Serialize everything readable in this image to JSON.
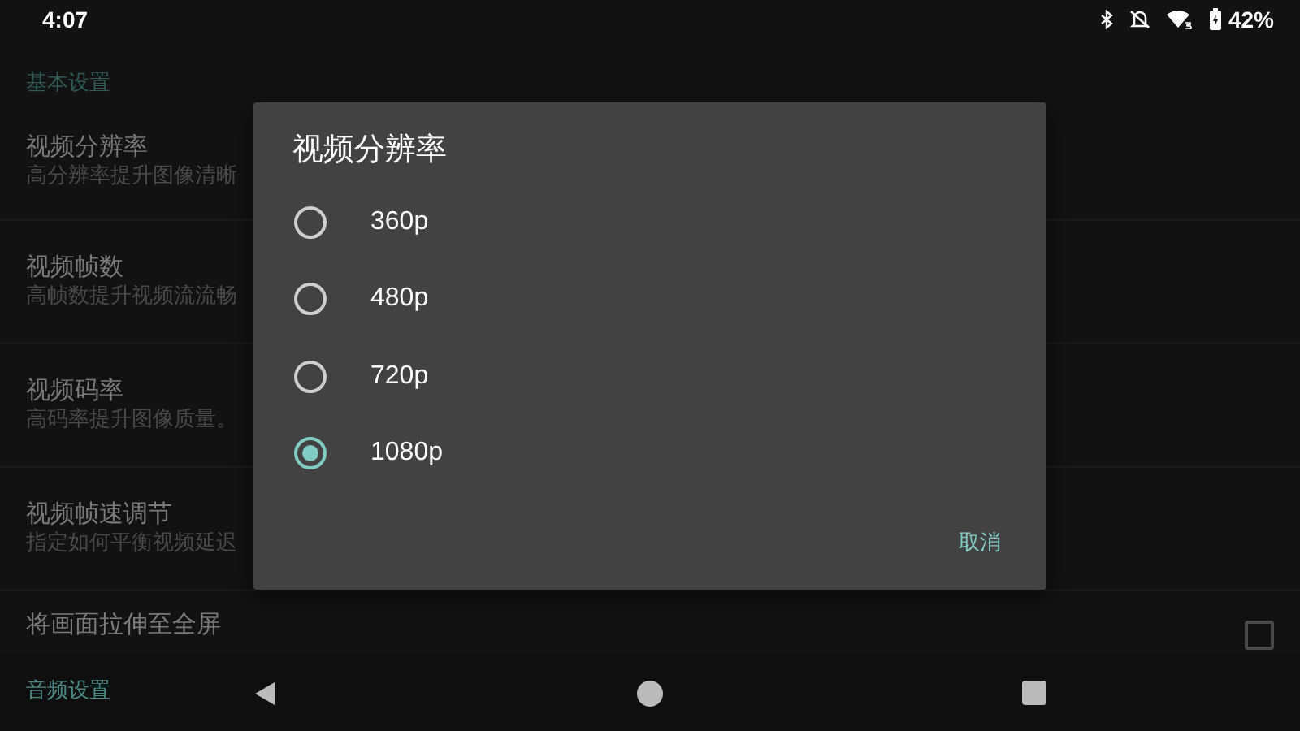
{
  "status_bar": {
    "time": "4:07",
    "battery": "42%"
  },
  "settings": {
    "section": "基本设置",
    "items": [
      {
        "kind": "text",
        "title": "视频分辨率",
        "summary": "高分辨率提升图像清晰"
      },
      {
        "kind": "text",
        "title": "视频帧数",
        "summary": "高帧数提升视频流流畅"
      },
      {
        "kind": "text",
        "title": "视频码率",
        "summary": "高码率提升图像质量。"
      },
      {
        "kind": "text",
        "title": "视频帧速调节",
        "summary": "指定如何平衡视频延迟"
      },
      {
        "kind": "checkbox",
        "title": "将画面拉伸至全屏",
        "checked": false
      }
    ],
    "next_section": "音频设置"
  },
  "dialog": {
    "title": "视频分辨率",
    "options": [
      {
        "label": "360p",
        "selected": false
      },
      {
        "label": "480p",
        "selected": false
      },
      {
        "label": "720p",
        "selected": false
      },
      {
        "label": "1080p",
        "selected": true
      }
    ],
    "cancel": "取消"
  }
}
